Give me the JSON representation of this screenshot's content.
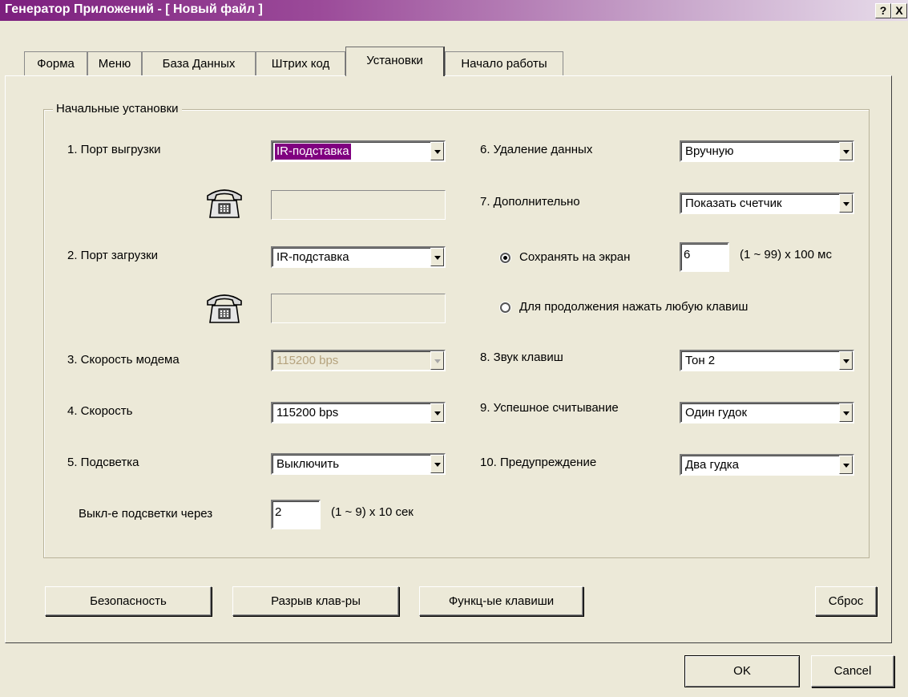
{
  "window": {
    "title": "Генератор Приложений - [ Новый файл ]",
    "help_label": "?",
    "close_label": "X"
  },
  "tabs": [
    "Форма",
    "Меню",
    "База Данных",
    "Штрих код",
    "Установки",
    "Начало работы"
  ],
  "group": {
    "title": "Начальные установки"
  },
  "left": {
    "upload_port": {
      "label": "1. Порт выгрузки",
      "value": "IR-подставка",
      "phone_number": ""
    },
    "download_port": {
      "label": "2. Порт загрузки",
      "value": "IR-подставка",
      "phone_number": ""
    },
    "modem_speed": {
      "label": "3. Скорость модема",
      "value": "115200 bps"
    },
    "speed": {
      "label": "4. Скорость",
      "value": "115200 bps"
    },
    "backlight": {
      "label": "5. Подсветка",
      "value": "Выключить"
    },
    "backlight_off": {
      "label": "Выкл-е подсветки через",
      "value": "2",
      "unit": "(1 ~ 9) x 10 сек"
    }
  },
  "right": {
    "delete_data": {
      "label": "6. Удаление данных",
      "value": "Вручную"
    },
    "additional": {
      "label": "7. Дополнительно",
      "value": "Показать счетчик"
    },
    "save_screen": {
      "label": "Сохранять на экран",
      "value": "6",
      "unit": "(1 ~ 99) x 100 мс"
    },
    "press_any_key": {
      "label": "Для продолжения нажать любую клавиш"
    },
    "key_sound": {
      "label": "8. Звук клавиш",
      "value": "Тон 2"
    },
    "good_read": {
      "label": "9. Успешное считывание",
      "value": "Один гудок"
    },
    "warning": {
      "label": "10. Предупреждение",
      "value": "Два гудка"
    }
  },
  "buttons": {
    "security": "Безопасность",
    "keyboard_break": "Разрыв клав-ры",
    "function_keys": "Функц-ые клавиши",
    "reset": "Сброс",
    "ok": "OK",
    "cancel": "Cancel"
  },
  "icons": {
    "phone": "telephone-icon"
  },
  "colors": {
    "title_start": "#7c1f7e",
    "title_end": "#e7dcea",
    "selection": "#800080",
    "face": "#ece9d8"
  }
}
